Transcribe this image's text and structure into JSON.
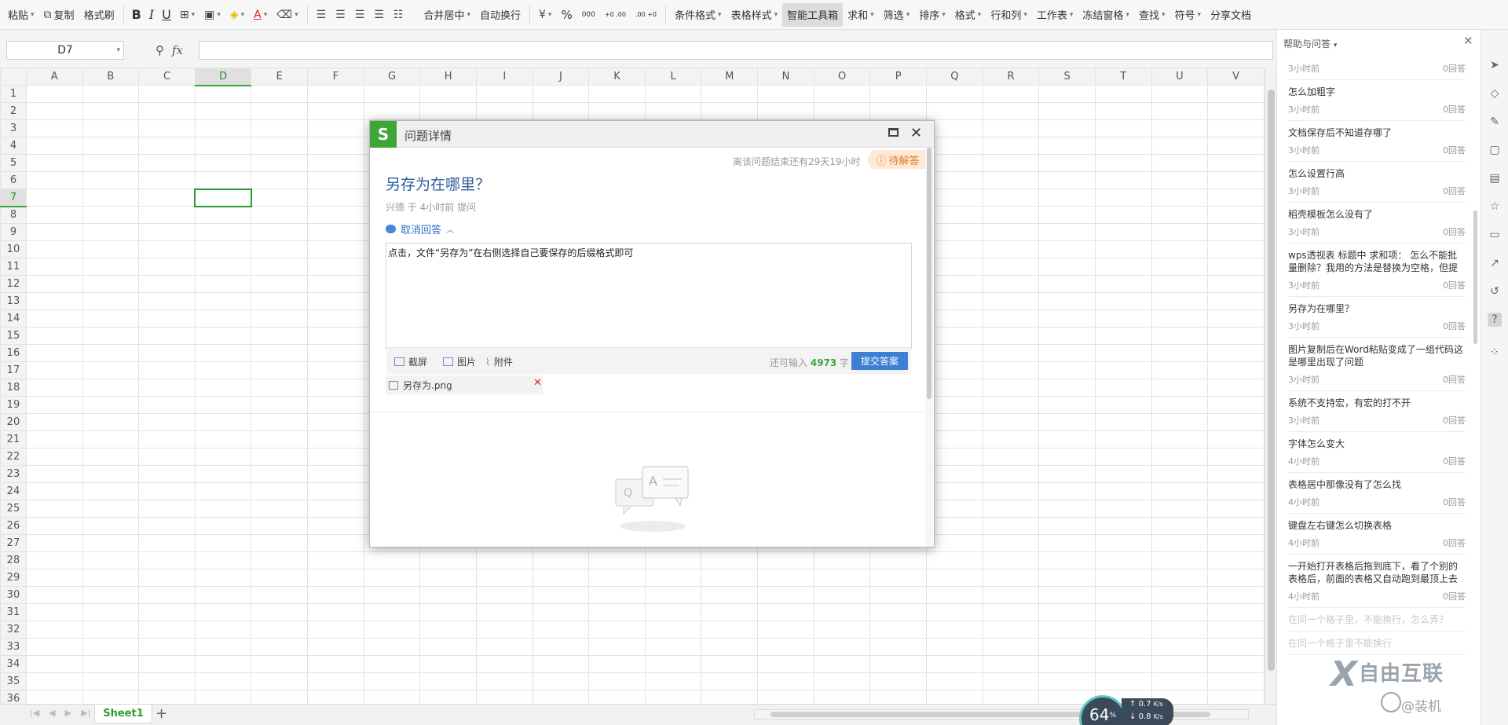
{
  "ribbon": {
    "paste": "粘贴",
    "copy": "复制",
    "format_painter": "格式刷",
    "bold": "B",
    "italic": "I",
    "underline": "U",
    "merge_center": "合并居中",
    "wrap_text": "自动换行",
    "percent": "%",
    "thousands": "000",
    "dec_add": "+0 .00",
    "dec_remove": ".00 +0",
    "conditional_format": "条件格式",
    "table_style": "表格样式",
    "smart_toolbox": "智能工具箱",
    "sum": "求和",
    "filter": "筛选",
    "sort": "排序",
    "format": "格式",
    "rows_cols": "行和列",
    "worksheet": "工作表",
    "freeze": "冻结窗格",
    "find": "查找",
    "symbol": "符号",
    "share_doc": "分享文档"
  },
  "formula_bar": {
    "cell_ref": "D7",
    "fx": "fx",
    "formula": ""
  },
  "grid": {
    "columns": [
      "A",
      "B",
      "C",
      "D",
      "E",
      "F",
      "G",
      "H",
      "I",
      "J",
      "K",
      "L",
      "M",
      "N",
      "O",
      "P",
      "Q",
      "R",
      "S",
      "T",
      "U",
      "V"
    ],
    "rows": [
      "1",
      "2",
      "3",
      "4",
      "5",
      "6",
      "7",
      "8",
      "9",
      "10",
      "11",
      "12",
      "13",
      "14",
      "15",
      "16",
      "17",
      "18",
      "19",
      "20",
      "21",
      "22",
      "23",
      "24",
      "25",
      "26",
      "27",
      "28",
      "29",
      "30",
      "31",
      "32",
      "33",
      "34",
      "35",
      "36"
    ],
    "active_col": "D",
    "active_row": "7"
  },
  "sheets": {
    "tabs": [
      "Sheet1"
    ],
    "add": "+"
  },
  "dialog": {
    "title": "问题详情",
    "logo": "S",
    "deadline": "离该问题结束还有29天19小时",
    "status": "待解答",
    "question": "另存为在哪里？",
    "meta": "兴德 于 4小时前 提问",
    "cancel_answer": "取消回答",
    "answer_text": "点击，文件“另存为”在右侧选择自己要保存的后缀格式即可",
    "tools": {
      "screenshot": "截屏",
      "image": "图片",
      "attachment": "附件"
    },
    "remaining_prefix": "还可输入",
    "remaining_count": "4973",
    "remaining_suffix": "字",
    "submit": "提交答案",
    "attachment_file": "另存为.png"
  },
  "panel": {
    "title": "帮助与问答",
    "items": [
      {
        "q": "",
        "time": "3小时前",
        "answers": "0回答"
      },
      {
        "q": "怎么加粗字",
        "time": "3小时前",
        "answers": "0回答"
      },
      {
        "q": "文档保存后不知道存哪了",
        "time": "3小时前",
        "answers": "0回答"
      },
      {
        "q": "怎么设置行高",
        "time": "3小时前",
        "answers": "0回答"
      },
      {
        "q": "稻壳模板怎么没有了",
        "time": "3小时前",
        "answers": "0回答"
      },
      {
        "q": "wps透视表 标题中 求和项： 怎么不能批量删除？我用的方法是替换为空格，但提",
        "time": "3小时前",
        "answers": "0回答"
      },
      {
        "q": "另存为在哪里？",
        "time": "3小时前",
        "answers": "0回答"
      },
      {
        "q": "图片复制后在Word粘贴变成了一组代码这是哪里出现了问题",
        "time": "3小时前",
        "answers": "0回答"
      },
      {
        "q": "系统不支持宏，有宏的打不开",
        "time": "3小时前",
        "answers": "0回答"
      },
      {
        "q": "字体怎么变大",
        "time": "4小时前",
        "answers": "0回答"
      },
      {
        "q": "表格居中那像没有了怎么找",
        "time": "4小时前",
        "answers": "0回答"
      },
      {
        "q": "键盘左右键怎么切换表格",
        "time": "4小时前",
        "answers": "0回答"
      },
      {
        "q": "一开始打开表格后拖到底下，看了个别的表格后，前面的表格又自动跑到最顶上去",
        "time": "4小时前",
        "answers": "0回答"
      },
      {
        "q": "在同一个格子里，不能换行，怎么弄？",
        "time": "",
        "answers": ""
      },
      {
        "q": "在同一个格子里不能换行",
        "time": "",
        "answers": ""
      }
    ]
  },
  "overlay": {
    "speed_percent": "64",
    "speed_unit": "%",
    "upload": "0.7",
    "download": "0.8",
    "rate_unit": "K/s",
    "watermark": "自由互联",
    "watermark_sub": "@装机"
  },
  "colors": {
    "accent_green": "#3ea537",
    "link_blue": "#2e6fc3",
    "title_blue": "#2e5c9b",
    "submit_blue": "#3d7fd2",
    "badge_orange": "#e37d2a"
  },
  "icons": {
    "paste": "clipboard-icon",
    "copy": "copy-icon",
    "format_painter": "brush-icon",
    "zoom": "search-icon",
    "close": "close-icon",
    "maximize": "maximize-icon"
  }
}
